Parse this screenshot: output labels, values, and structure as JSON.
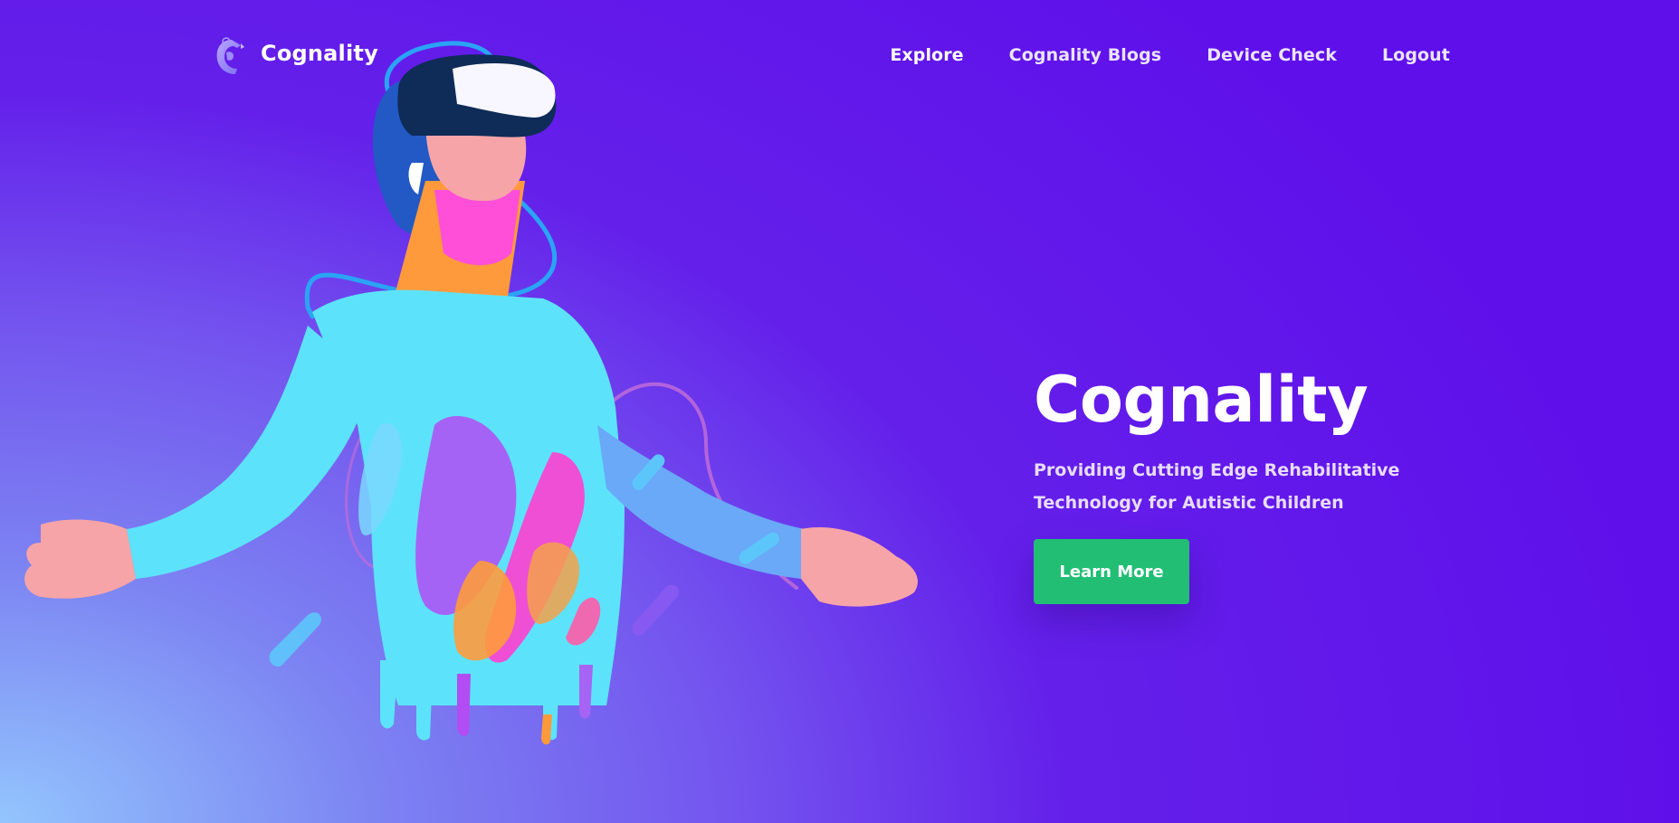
{
  "brand": {
    "name": "Cognality",
    "logo_icon": "brain-head-logo-icon"
  },
  "nav": {
    "items": [
      {
        "label": "Explore"
      },
      {
        "label": "Cognality Blogs"
      },
      {
        "label": "Device Check"
      },
      {
        "label": "Logout"
      }
    ]
  },
  "hero": {
    "title": "Cognality",
    "subtitle": "Providing Cutting Edge Rehabilitative Technology for Autistic Children",
    "cta_label": "Learn More",
    "illustration": "vr-headset-person-illustration"
  },
  "colors": {
    "background_primary": "#5f0fea",
    "background_corner": "#93c5fd",
    "cta_green": "#22be74",
    "text_white": "#ffffff"
  }
}
